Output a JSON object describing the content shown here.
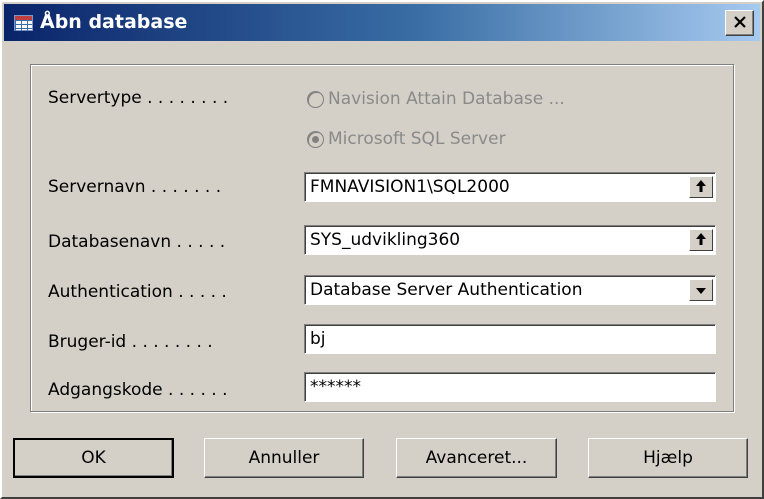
{
  "window": {
    "title": "Åbn database",
    "close_label": "✕",
    "app_icon": "database-table-icon"
  },
  "form": {
    "servertype_label": "Servertype . . . . . . . .",
    "servertype_options": [
      {
        "label": "Navision Attain Database ...",
        "checked": false
      },
      {
        "label": "Microsoft SQL Server",
        "checked": true
      }
    ],
    "servernavn_label": "Servernavn . . . . . . .",
    "servernavn_value": "FMNAVISION1\\SQL2000",
    "databasenavn_label": "Databasenavn . . . . .",
    "databasenavn_value": "SYS_udvikling360",
    "authentication_label": "Authentication . . . . .",
    "authentication_value": "Database Server Authentication",
    "bruger_label": "Bruger-id . . . . . . . .",
    "bruger_value": "bj",
    "adgangskode_label": "Adgangskode . . . . . .",
    "adgangskode_value": "******",
    "lookup_icon": "up-arrow-lookup-icon",
    "dropdown_icon": "down-arrow-icon"
  },
  "buttons": {
    "ok": "OK",
    "annuller": "Annuller",
    "avanceret": "Avanceret...",
    "hjaelp": "Hjælp"
  }
}
